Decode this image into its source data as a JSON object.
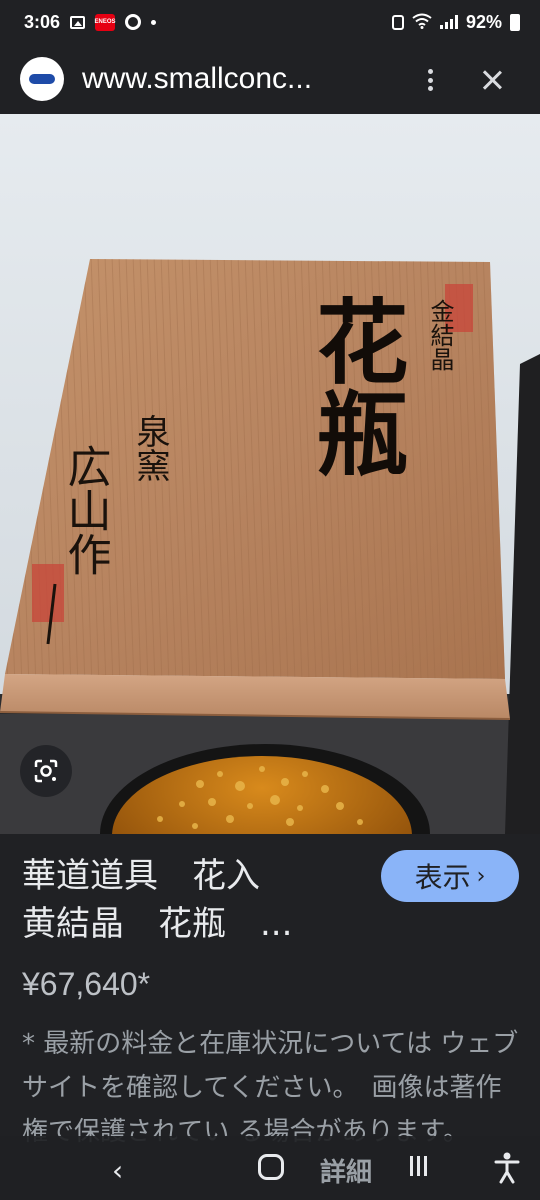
{
  "status_bar": {
    "time": "3:06",
    "battery": "92%"
  },
  "url_bar": {
    "url": "www.smallconc..."
  },
  "image": {
    "box_text_right_small": "金結晶",
    "box_text_main": "花瓶",
    "box_text_left_small": "泉窯",
    "box_text_signature": "広山作"
  },
  "product": {
    "title": "華道道具　花入\n黄結晶　花瓶　...",
    "view_button_label": "表示",
    "price": "¥67,640*",
    "disclaimer": "* 最新の料金と在庫状況については ウェブサイトを確認してください。　画像は著作権で保護されてい る場合があります。"
  },
  "nav_bar": {
    "details_label": "詳細"
  },
  "colors": {
    "background": "#202124",
    "accent_button": "#8ab4f8"
  }
}
